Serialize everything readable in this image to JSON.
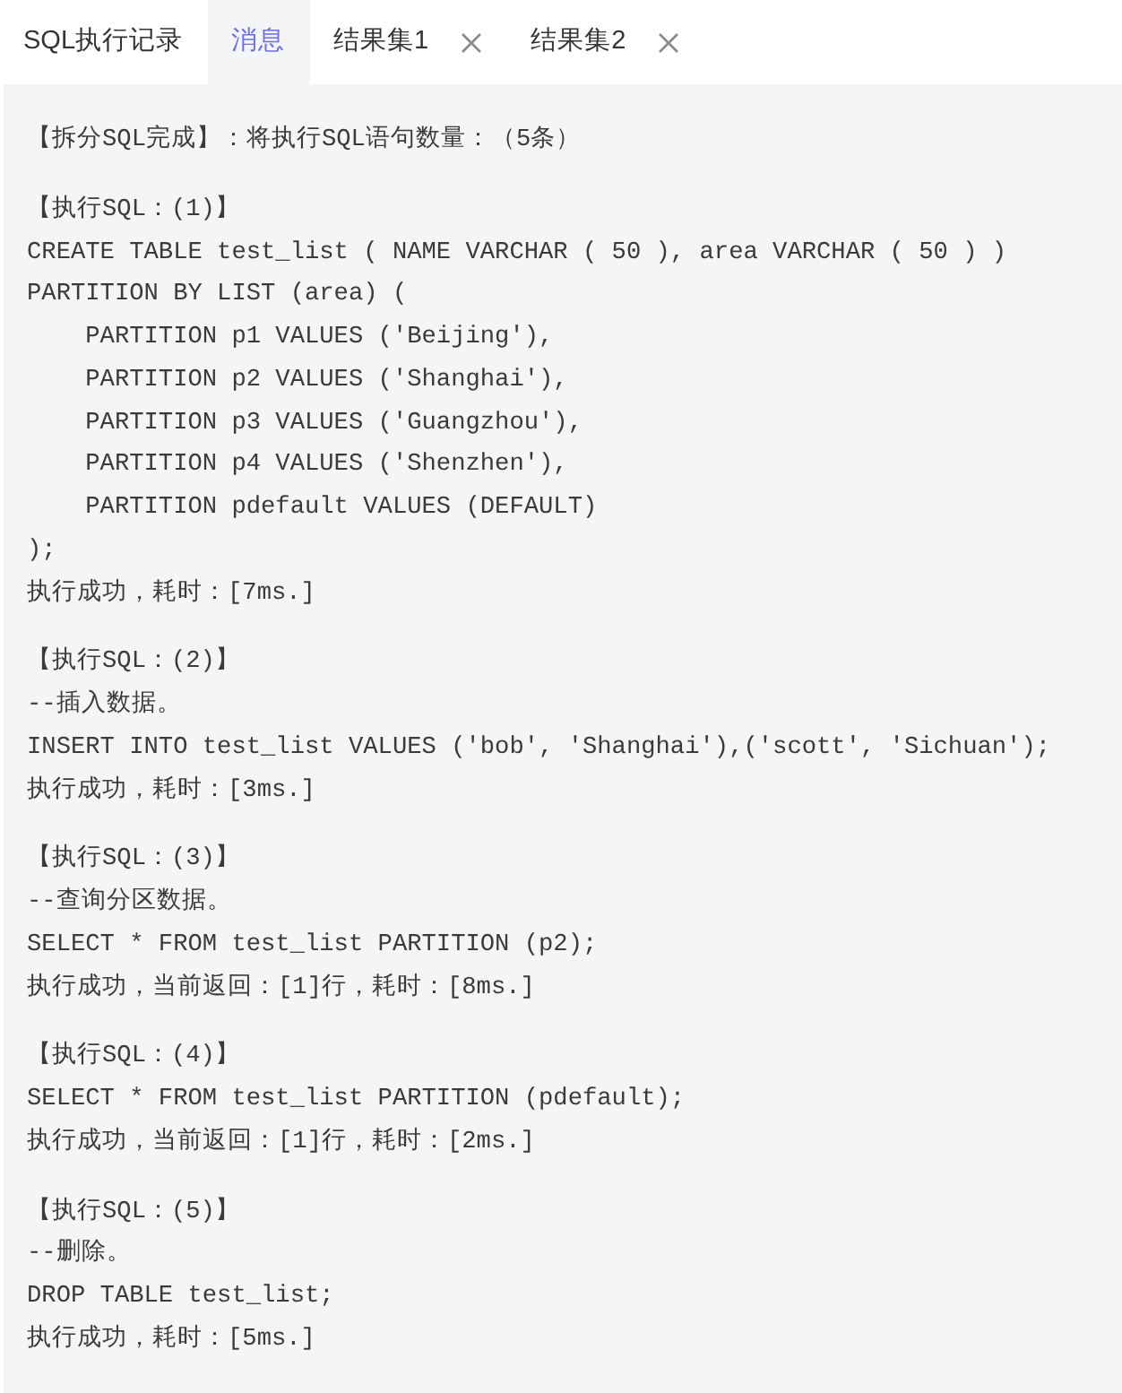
{
  "tabs": [
    {
      "label": "SQL执行记录",
      "selected": false,
      "closable": false
    },
    {
      "label": "消息",
      "selected": true,
      "closable": false
    },
    {
      "label": "结果集1",
      "selected": false,
      "closable": true
    },
    {
      "label": "结果集2",
      "selected": false,
      "closable": true
    }
  ],
  "messages": {
    "summary": "【拆分SQL完成】：将执行SQL语句数量：（5条）",
    "blocks": [
      {
        "header": "【执行SQL：(1)】",
        "lines": [
          "CREATE TABLE test_list ( NAME VARCHAR ( 50 ), area VARCHAR ( 50 ) )",
          "PARTITION BY LIST (area) (",
          "    PARTITION p1 VALUES ('Beijing'),",
          "    PARTITION p2 VALUES ('Shanghai'),",
          "    PARTITION p3 VALUES ('Guangzhou'),",
          "    PARTITION p4 VALUES ('Shenzhen'),",
          "    PARTITION pdefault VALUES (DEFAULT)",
          ");"
        ],
        "result": "执行成功，耗时：[7ms.]"
      },
      {
        "header": "【执行SQL：(2)】",
        "lines": [
          "--插入数据。",
          "INSERT INTO test_list VALUES ('bob', 'Shanghai'),('scott', 'Sichuan');"
        ],
        "result": "执行成功，耗时：[3ms.]"
      },
      {
        "header": "【执行SQL：(3)】",
        "lines": [
          "--查询分区数据。",
          "SELECT * FROM test_list PARTITION (p2);"
        ],
        "result": "执行成功，当前返回：[1]行，耗时：[8ms.]"
      },
      {
        "header": "【执行SQL：(4)】",
        "lines": [
          "SELECT * FROM test_list PARTITION (pdefault);"
        ],
        "result": "执行成功，当前返回：[1]行，耗时：[2ms.]"
      },
      {
        "header": "【执行SQL：(5)】",
        "lines": [
          "--删除。",
          "DROP TABLE test_list;"
        ],
        "result": "执行成功，耗时：[5ms.]"
      }
    ]
  }
}
